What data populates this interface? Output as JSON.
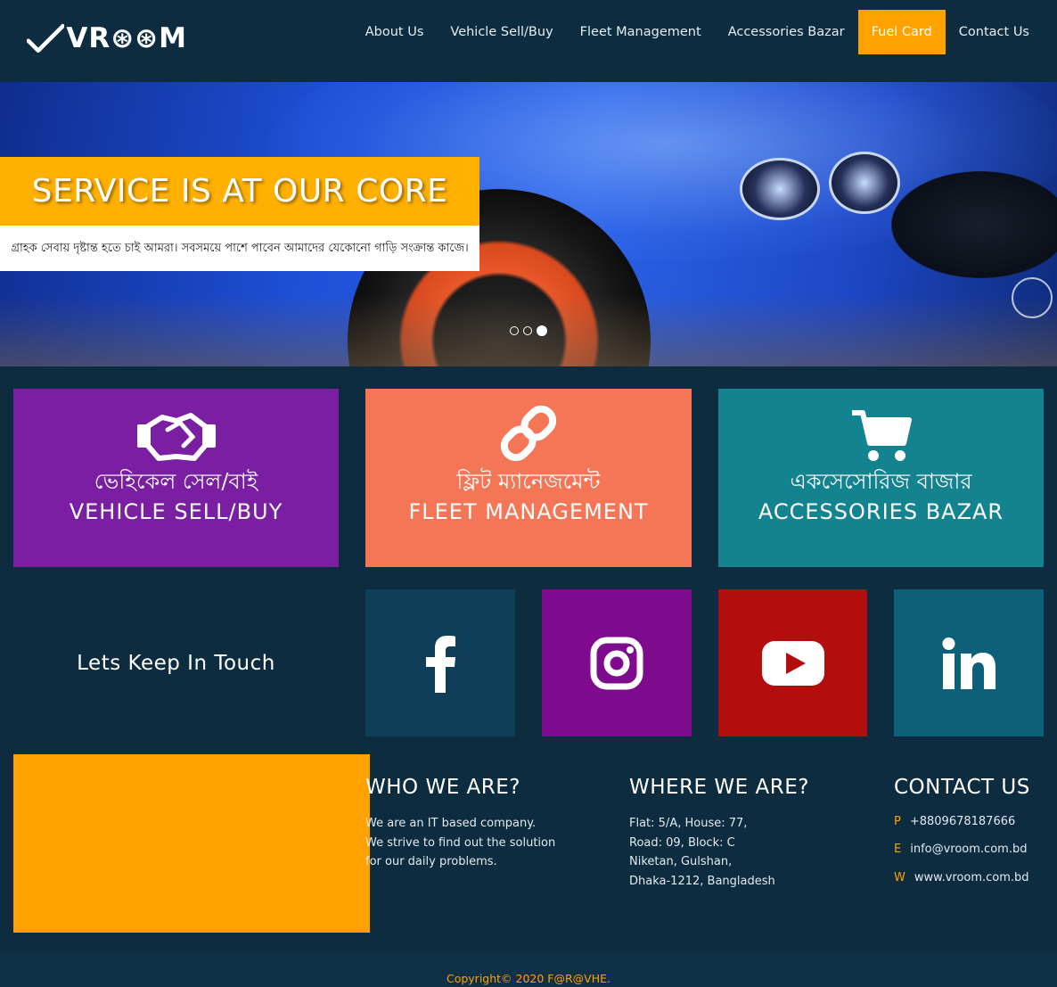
{
  "brand": {
    "logo_text": "VR⊛⊛M",
    "accent": "#ffa200"
  },
  "nav": {
    "items": [
      {
        "label": "About Us"
      },
      {
        "label": "Vehicle Sell/Buy"
      },
      {
        "label": "Fleet Management"
      },
      {
        "label": "Accessories Bazar"
      },
      {
        "label": "Fuel Card",
        "active": true
      },
      {
        "label": "Contact Us"
      }
    ]
  },
  "hero": {
    "title": "SERVICE IS AT OUR CORE",
    "subtitle": "গ্রাহক সেবায় দৃষ্টান্ত হতে চাই আমরা। সবসময়ে পাশে পাবেন আমাদের যেকোনো গাড়ি সংক্রান্ত কাজে।",
    "slides": 3,
    "active_slide": 3
  },
  "services": [
    {
      "bn": "ভেহিকেল সেল/বাই",
      "en": "VEHICLE SELL/BUY",
      "color": "#7a1fa2",
      "icon": "handshake-icon"
    },
    {
      "bn": "ফ্লিট ম্যানেজমেন্ট",
      "en": "FLEET MANAGEMENT",
      "color": "#f47656",
      "icon": "chain-link-icon"
    },
    {
      "bn": "একসেসোরিজ বাজার",
      "en": "ACCESSORIES BAZAR",
      "color": "#13838f",
      "icon": "shopping-cart-icon"
    }
  ],
  "social": {
    "heading": "Lets Keep In Touch",
    "items": [
      {
        "name": "facebook-icon",
        "color": "#0f3e58"
      },
      {
        "name": "instagram-icon",
        "color": "#7e0a8e"
      },
      {
        "name": "youtube-icon",
        "color": "#b20e0e"
      },
      {
        "name": "linkedin-icon",
        "color": "#0d607a"
      }
    ]
  },
  "who": {
    "title": "WHO WE ARE?",
    "lines": [
      "We are an IT based company.",
      "We strive to find out the solution",
      "for our daily problems."
    ]
  },
  "where": {
    "title": "WHERE WE ARE?",
    "lines": [
      "Flat: 5/A, House: 77,",
      "Road: 09, Block: C",
      "Niketan, Gulshan,",
      "Dhaka-1212, Bangladesh"
    ]
  },
  "contact": {
    "title": "CONTACT US",
    "phone_key": "P",
    "phone": "+8809678187666",
    "email_key": "E",
    "email": "info@vroom.com.bd",
    "web_key": "W",
    "web": "www.vroom.com.bd"
  },
  "footer": {
    "copyright": "Copyright© 2020 F@R@VHE."
  }
}
